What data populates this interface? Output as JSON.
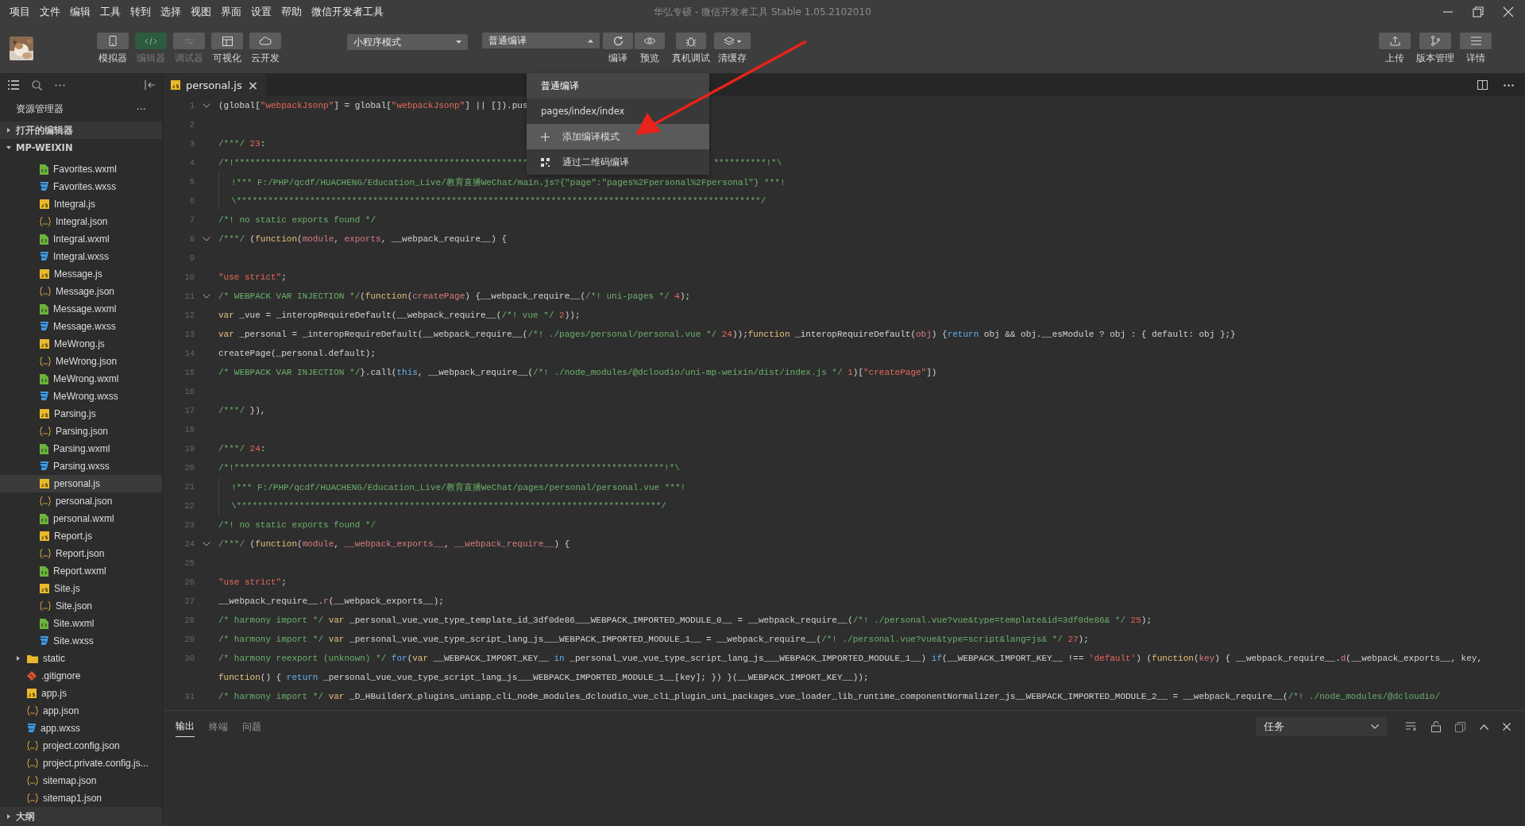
{
  "menu_bar": {
    "items": [
      "项目",
      "文件",
      "编辑",
      "工具",
      "转到",
      "选择",
      "视图",
      "界面",
      "设置",
      "帮助",
      "微信开发者工具"
    ],
    "title": "华弘专硕 - 微信开发者工具 Stable 1.05.2102010"
  },
  "toolbar": {
    "toggles": [
      {
        "label": "模拟器",
        "on": false,
        "disabled": false
      },
      {
        "label": "编辑器",
        "on": true,
        "disabled": true
      },
      {
        "label": "调试器",
        "on": false,
        "disabled": true
      },
      {
        "label": "可视化",
        "on": false,
        "disabled": false
      },
      {
        "label": "云开发",
        "on": false,
        "disabled": false
      }
    ],
    "mode_select": {
      "value": "小程序模式"
    },
    "compile_select": {
      "value": "普通编译",
      "expanded": true
    },
    "actions": [
      {
        "label": "编译"
      },
      {
        "label": "预览"
      },
      {
        "label": "真机调试"
      },
      {
        "label": "清缓存"
      }
    ],
    "right_actions": [
      {
        "label": "上传"
      },
      {
        "label": "版本管理"
      },
      {
        "label": "详情"
      }
    ]
  },
  "compile_menu": {
    "items": [
      {
        "kind": "option",
        "label": "普通编译",
        "selected": true,
        "highlighted": false
      },
      {
        "kind": "option",
        "label": "pages/index/index",
        "selected": false,
        "highlighted": false
      },
      {
        "kind": "add",
        "label": "添加编译模式",
        "selected": false,
        "highlighted": true
      },
      {
        "kind": "qr",
        "label": "通过二维码编译",
        "selected": false,
        "highlighted": false
      }
    ]
  },
  "sidebar": {
    "title": "资源管理器",
    "more": "···",
    "sections": [
      {
        "label": "打开的编辑器",
        "expanded": false
      },
      {
        "label": "MP-WEIXIN",
        "expanded": true
      }
    ],
    "tree": [
      {
        "kind": "group",
        "children": [
          {
            "label": "Favorites.wxml",
            "kind": "wxml",
            "selected": false
          },
          {
            "label": "Favorites.wxss",
            "kind": "wxss",
            "selected": false
          },
          {
            "label": "Integral.js",
            "kind": "js",
            "selected": false
          },
          {
            "label": "Integral.json",
            "kind": "json",
            "selected": false
          },
          {
            "label": "Integral.wxml",
            "kind": "wxml",
            "selected": false
          },
          {
            "label": "Integral.wxss",
            "kind": "wxss",
            "selected": false
          },
          {
            "label": "Message.js",
            "kind": "js",
            "selected": false
          },
          {
            "label": "Message.json",
            "kind": "json",
            "selected": false
          },
          {
            "label": "Message.wxml",
            "kind": "wxml",
            "selected": false
          },
          {
            "label": "Message.wxss",
            "kind": "wxss",
            "selected": false
          },
          {
            "label": "MeWrong.js",
            "kind": "js",
            "selected": false
          },
          {
            "label": "MeWrong.json",
            "kind": "json",
            "selected": false
          },
          {
            "label": "MeWrong.wxml",
            "kind": "wxml",
            "selected": false
          },
          {
            "label": "MeWrong.wxss",
            "kind": "wxss",
            "selected": false
          },
          {
            "label": "Parsing.js",
            "kind": "js",
            "selected": false
          },
          {
            "label": "Parsing.json",
            "kind": "json",
            "selected": false
          },
          {
            "label": "Parsing.wxml",
            "kind": "wxml",
            "selected": false
          },
          {
            "label": "Parsing.wxss",
            "kind": "wxss",
            "selected": false
          },
          {
            "label": "personal.js",
            "kind": "js",
            "selected": true
          },
          {
            "label": "personal.json",
            "kind": "json",
            "selected": false
          },
          {
            "label": "personal.wxml",
            "kind": "wxml",
            "selected": false
          },
          {
            "label": "Report.js",
            "kind": "js",
            "selected": false
          },
          {
            "label": "Report.json",
            "kind": "json",
            "selected": false
          },
          {
            "label": "Report.wxml",
            "kind": "wxml",
            "selected": false
          },
          {
            "label": "Site.js",
            "kind": "js",
            "selected": false
          },
          {
            "label": "Site.json",
            "kind": "json",
            "selected": false
          },
          {
            "label": "Site.wxml",
            "kind": "wxml",
            "selected": false
          },
          {
            "label": "Site.wxss",
            "kind": "wxss",
            "selected": false
          }
        ]
      },
      {
        "kind": "folder",
        "label": "static",
        "expanded": false,
        "selected": false
      },
      {
        "kind": "git",
        "label": ".gitignore",
        "selected": false
      },
      {
        "kind": "js",
        "label": "app.js",
        "selected": false
      },
      {
        "kind": "json",
        "label": "app.json",
        "selected": false
      },
      {
        "kind": "wxss",
        "label": "app.wxss",
        "selected": false
      },
      {
        "kind": "json",
        "label": "project.config.json",
        "selected": false
      },
      {
        "kind": "json",
        "label": "project.private.config.js...",
        "selected": false
      },
      {
        "kind": "json",
        "label": "sitemap.json",
        "selected": false
      },
      {
        "kind": "json",
        "label": "sitemap1.json",
        "selected": false
      }
    ],
    "outline": {
      "label": "大纲",
      "expanded": false
    }
  },
  "editor": {
    "tab": {
      "label": "personal.js",
      "close": "×"
    },
    "lines": [
      {
        "number": "1",
        "fold": true,
        "segments": [
          {
            "kind": "plain",
            "text": "(global["
          },
          {
            "kind": "string",
            "text": "\"webpackJsonp\""
          },
          {
            "kind": "plain",
            "text": "] = global["
          },
          {
            "kind": "string",
            "text": "\"webpackJsonp\""
          },
          {
            "kind": "plain",
            "text": "] || []).pus"
          }
        ]
      },
      {
        "number": "2"
      },
      {
        "number": "3",
        "segments": [
          {
            "kind": "comment",
            "text": "/***/ "
          },
          {
            "kind": "number",
            "text": "23"
          },
          {
            "kind": "plain",
            "text": ":"
          }
        ]
      },
      {
        "number": "4",
        "segments": [
          {
            "kind": "comment",
            "text": "/*!********************************************************"
          }
        ],
        "tail": [
          {
            "kind": "comment",
            "text": "**********!*\\"
          }
        ]
      },
      {
        "number": "5",
        "guide": true,
        "segments": [
          {
            "kind": "comment",
            "text": "!*** F:/PHP/qcdf/HUACHENG/Education_Live/教育直播WeChat/main.js?{\"page\":\"pages%2Fpersonal%2Fpersonal\"} ***!"
          }
        ]
      },
      {
        "number": "6",
        "guide": true,
        "segments": [
          {
            "kind": "comment",
            "text": "\\****************************************************************************************************/"
          }
        ]
      },
      {
        "number": "7",
        "segments": [
          {
            "kind": "comment",
            "text": "/*! no static exports found */"
          }
        ]
      },
      {
        "number": "8",
        "fold": true,
        "segments": [
          {
            "kind": "comment",
            "text": "/***/ "
          },
          {
            "kind": "plain",
            "text": "("
          },
          {
            "kind": "keyword",
            "text": "function"
          },
          {
            "kind": "plain",
            "text": "("
          },
          {
            "kind": "param",
            "text": "module"
          },
          {
            "kind": "plain",
            "text": ", "
          },
          {
            "kind": "param",
            "text": "exports"
          },
          {
            "kind": "plain",
            "text": ", __webpack_require__) {"
          }
        ]
      },
      {
        "number": "9"
      },
      {
        "number": "10",
        "segments": [
          {
            "kind": "string",
            "text": "\"use strict\""
          },
          {
            "kind": "plain",
            "text": ";"
          }
        ]
      },
      {
        "number": "11",
        "fold": true,
        "segments": [
          {
            "kind": "comment",
            "text": "/* WEBPACK VAR INJECTION */"
          },
          {
            "kind": "plain",
            "text": "("
          },
          {
            "kind": "keyword",
            "text": "function"
          },
          {
            "kind": "plain",
            "text": "("
          },
          {
            "kind": "param",
            "text": "createPage"
          },
          {
            "kind": "plain",
            "text": ") {__webpack_require__("
          },
          {
            "kind": "comment",
            "text": "/*! uni-pages */ "
          },
          {
            "kind": "number",
            "text": "4"
          },
          {
            "kind": "plain",
            "text": ");"
          }
        ]
      },
      {
        "number": "12",
        "segments": [
          {
            "kind": "keyword",
            "text": "var"
          },
          {
            "kind": "plain",
            "text": " _vue = _interopRequireDefault(__webpack_require__("
          },
          {
            "kind": "comment",
            "text": "/*! vue */ "
          },
          {
            "kind": "number",
            "text": "2"
          },
          {
            "kind": "plain",
            "text": "));"
          }
        ]
      },
      {
        "number": "13",
        "segments": [
          {
            "kind": "keyword",
            "text": "var"
          },
          {
            "kind": "plain",
            "text": " _personal = _interopRequireDefault(__webpack_require__("
          },
          {
            "kind": "comment",
            "text": "/*! ./pages/personal/personal.vue */ "
          },
          {
            "kind": "number",
            "text": "24"
          },
          {
            "kind": "plain",
            "text": "));"
          },
          {
            "kind": "keyword",
            "text": "function"
          },
          {
            "kind": "plain",
            "text": " _interopRequireDefault("
          },
          {
            "kind": "param",
            "text": "obj"
          },
          {
            "kind": "plain",
            "text": ") {"
          },
          {
            "kind": "control",
            "text": "return"
          },
          {
            "kind": "plain",
            "text": " obj && obj.__esModule ? obj : { default: obj };}"
          }
        ]
      },
      {
        "number": "14",
        "segments": [
          {
            "kind": "plain",
            "text": "createPage(_personal.default);"
          }
        ]
      },
      {
        "number": "15",
        "segments": [
          {
            "kind": "comment",
            "text": "/* WEBPACK VAR INJECTION */"
          },
          {
            "kind": "plain",
            "text": "}.call("
          },
          {
            "kind": "control",
            "text": "this"
          },
          {
            "kind": "plain",
            "text": ", __webpack_require__("
          },
          {
            "kind": "comment",
            "text": "/*! ./node_modules/@dcloudio/uni-mp-weixin/dist/index.js */ "
          },
          {
            "kind": "number",
            "text": "1"
          },
          {
            "kind": "plain",
            "text": ")["
          },
          {
            "kind": "string",
            "text": "\"createPage\""
          },
          {
            "kind": "plain",
            "text": "])"
          }
        ]
      },
      {
        "number": "16"
      },
      {
        "number": "17",
        "segments": [
          {
            "kind": "comment",
            "text": "/***/ "
          },
          {
            "kind": "plain",
            "text": "}),"
          }
        ]
      },
      {
        "number": "18"
      },
      {
        "number": "19",
        "segments": [
          {
            "kind": "comment",
            "text": "/***/ "
          },
          {
            "kind": "number",
            "text": "24"
          },
          {
            "kind": "plain",
            "text": ":"
          }
        ]
      },
      {
        "number": "20",
        "segments": [
          {
            "kind": "comment",
            "text": "/*!**********************************************************************************!*\\"
          }
        ]
      },
      {
        "number": "21",
        "guide": true,
        "segments": [
          {
            "kind": "comment",
            "text": "!*** F:/PHP/qcdf/HUACHENG/Education_Live/教育直播WeChat/pages/personal/personal.vue ***!"
          }
        ]
      },
      {
        "number": "22",
        "guide": true,
        "segments": [
          {
            "kind": "comment",
            "text": "\\*********************************************************************************/"
          }
        ]
      },
      {
        "number": "23",
        "segments": [
          {
            "kind": "comment",
            "text": "/*! no static exports found */"
          }
        ]
      },
      {
        "number": "24",
        "fold": true,
        "segments": [
          {
            "kind": "comment",
            "text": "/***/ "
          },
          {
            "kind": "plain",
            "text": "("
          },
          {
            "kind": "keyword",
            "text": "function"
          },
          {
            "kind": "plain",
            "text": "("
          },
          {
            "kind": "param",
            "text": "module"
          },
          {
            "kind": "plain",
            "text": ", "
          },
          {
            "kind": "param",
            "text": "__webpack_exports__"
          },
          {
            "kind": "plain",
            "text": ", "
          },
          {
            "kind": "param",
            "text": "__webpack_require__"
          },
          {
            "kind": "plain",
            "text": ") {"
          }
        ]
      },
      {
        "number": "25"
      },
      {
        "number": "26",
        "segments": [
          {
            "kind": "string",
            "text": "\"use strict\""
          },
          {
            "kind": "plain",
            "text": ";"
          }
        ]
      },
      {
        "number": "27",
        "segments": [
          {
            "kind": "plain",
            "text": "__webpack_require__."
          },
          {
            "kind": "param",
            "text": "r"
          },
          {
            "kind": "plain",
            "text": "(__webpack_exports__);"
          }
        ]
      },
      {
        "number": "28",
        "segments": [
          {
            "kind": "comment",
            "text": "/* harmony import */ "
          },
          {
            "kind": "keyword",
            "text": "var"
          },
          {
            "kind": "plain",
            "text": " _personal_vue_vue_type_template_id_3df0de86___WEBPACK_IMPORTED_MODULE_0__ = __webpack_require__("
          },
          {
            "kind": "comment",
            "text": "/*! ./personal.vue?vue&type=template&id=3df0de86& */ "
          },
          {
            "kind": "number",
            "text": "25"
          },
          {
            "kind": "plain",
            "text": ");"
          }
        ]
      },
      {
        "number": "29",
        "segments": [
          {
            "kind": "comment",
            "text": "/* harmony import */ "
          },
          {
            "kind": "keyword",
            "text": "var"
          },
          {
            "kind": "plain",
            "text": " _personal_vue_vue_type_script_lang_js___WEBPACK_IMPORTED_MODULE_1__ = __webpack_require__("
          },
          {
            "kind": "comment",
            "text": "/*! ./personal.vue?vue&type=script&lang=js& */ "
          },
          {
            "kind": "number",
            "text": "27"
          },
          {
            "kind": "plain",
            "text": ");"
          }
        ]
      },
      {
        "number": "30",
        "segments": [
          {
            "kind": "comment",
            "text": "/* harmony reexport (unknown) */ "
          },
          {
            "kind": "control",
            "text": "for"
          },
          {
            "kind": "plain",
            "text": "("
          },
          {
            "kind": "keyword",
            "text": "var"
          },
          {
            "kind": "plain",
            "text": " __WEBPACK_IMPORT_KEY__ "
          },
          {
            "kind": "control",
            "text": "in"
          },
          {
            "kind": "plain",
            "text": " _personal_vue_vue_type_script_lang_js___WEBPACK_IMPORTED_MODULE_1__) "
          },
          {
            "kind": "control",
            "text": "if"
          },
          {
            "kind": "plain",
            "text": "(__WEBPACK_IMPORT_KEY__ !== "
          },
          {
            "kind": "string",
            "text": "'default'"
          },
          {
            "kind": "plain",
            "text": ") ("
          },
          {
            "kind": "keyword",
            "text": "function"
          },
          {
            "kind": "plain",
            "text": "("
          },
          {
            "kind": "param",
            "text": "key"
          },
          {
            "kind": "plain",
            "text": ") { __webpack_require__."
          },
          {
            "kind": "param",
            "text": "d"
          },
          {
            "kind": "plain",
            "text": "(__webpack_exports__, key,"
          }
        ]
      },
      {
        "segments": [
          {
            "kind": "keyword",
            "text": "function"
          },
          {
            "kind": "plain",
            "text": "() { "
          },
          {
            "kind": "control",
            "text": "return"
          },
          {
            "kind": "plain",
            "text": " _personal_vue_vue_type_script_lang_js___WEBPACK_IMPORTED_MODULE_1__[key]; }) }(__WEBPACK_IMPORT_KEY__));"
          }
        ]
      },
      {
        "number": "31",
        "segments": [
          {
            "kind": "comment",
            "text": "/* harmony import */ "
          },
          {
            "kind": "keyword",
            "text": "var"
          },
          {
            "kind": "plain",
            "text": " _D_HBuilderX_plugins_uniapp_cli_node_modules_dcloudio_vue_cli_plugin_uni_packages_vue_loader_lib_runtime_componentNormalizer_js__WEBPACK_IMPORTED_MODULE_2__ = __webpack_require__("
          },
          {
            "kind": "comment",
            "text": "/*! ./node_modules/@dcloudio/"
          }
        ]
      }
    ]
  },
  "panel": {
    "tabs": [
      {
        "label": "输出",
        "selected": true
      },
      {
        "label": "终端",
        "selected": false
      },
      {
        "label": "问题",
        "selected": false
      }
    ],
    "task_select": {
      "value": "任务"
    }
  }
}
